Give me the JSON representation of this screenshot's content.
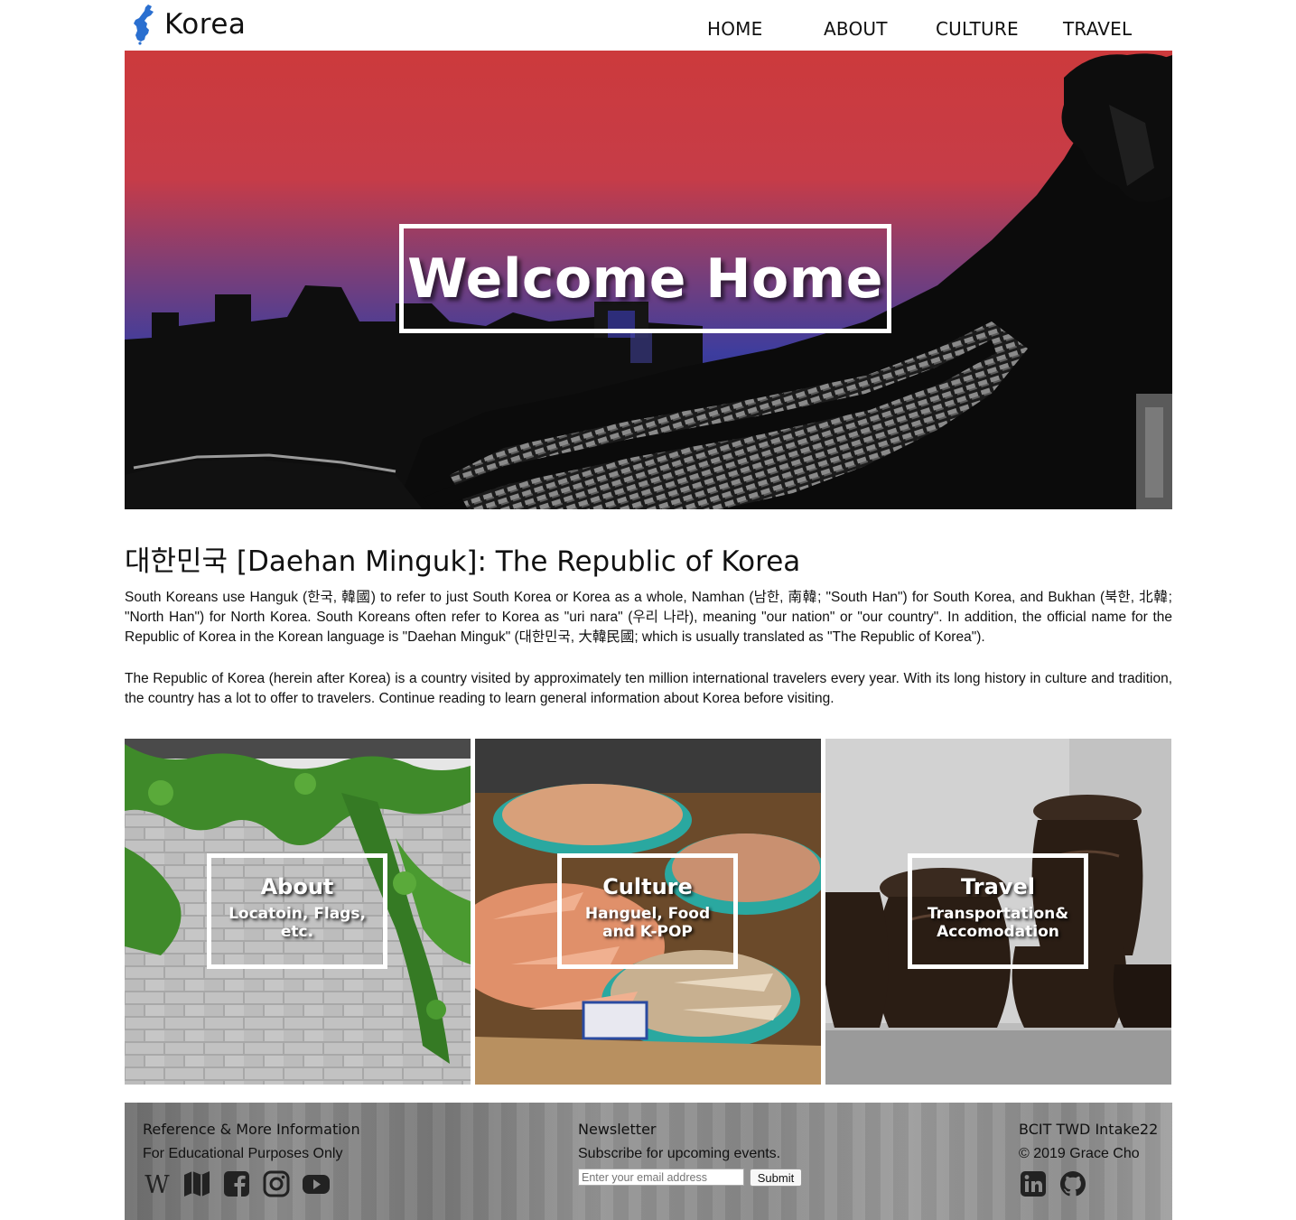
{
  "header": {
    "logo_text": "Korea",
    "nav": [
      "HOME",
      "ABOUT",
      "CULTURE",
      "TRAVEL"
    ]
  },
  "hero": {
    "title": "Welcome Home"
  },
  "intro": {
    "title": "대한민국 [Daehan Minguk]: The Republic of Korea",
    "paragraphs": [
      "South Koreans use Hanguk (한국, 韓國) to refer to just South Korea or Korea as a whole, Namhan (남한, 南韓; \"South Han\") for South Korea, and Bukhan (북한, 北韓; \"North Han\") for North Korea. South Koreans often refer to Korea as \"uri nara\" (우리 나라), meaning \"our nation\" or \"our country\". In addition, the official name for the Republic of Korea in the Korean language is \"Daehan Minguk\" (대한민국, 大韓民國; which is usually translated as \"The Republic of Korea\").",
      "The Republic of Korea (herein after Korea) is a country visited by approximately ten million international travelers every year. With its long history in culture and tradition, the country has a lot to offer to travelers. Continue reading to learn general information about Korea before visiting."
    ]
  },
  "cards": [
    {
      "title": "About",
      "subtitle": "Locatoin, Flags, etc."
    },
    {
      "title": "Culture",
      "subtitle": "Hanguel, Food and K-POP"
    },
    {
      "title": "Travel",
      "subtitle": "Transportation& Accomodation"
    }
  ],
  "footer": {
    "reference": {
      "heading": "Reference & More Information",
      "text": "For Educational Purposes Only",
      "icons": [
        "wikipedia-icon",
        "map-icon",
        "facebook-icon",
        "instagram-icon",
        "youtube-icon"
      ]
    },
    "newsletter": {
      "heading": "Newsletter",
      "text": "Subscribe for upcoming events.",
      "placeholder": "Enter your email address",
      "button": "Submit"
    },
    "credits": {
      "heading": "BCIT TWD Intake22",
      "text": "© 2019 Grace Cho",
      "icons": [
        "linkedin-icon",
        "github-icon"
      ]
    }
  },
  "colors": {
    "hero_top": "#cc3a3c",
    "hero_bottom": "#3d3d9e",
    "logo_blue": "#2a6fd0",
    "text": "#111111"
  }
}
